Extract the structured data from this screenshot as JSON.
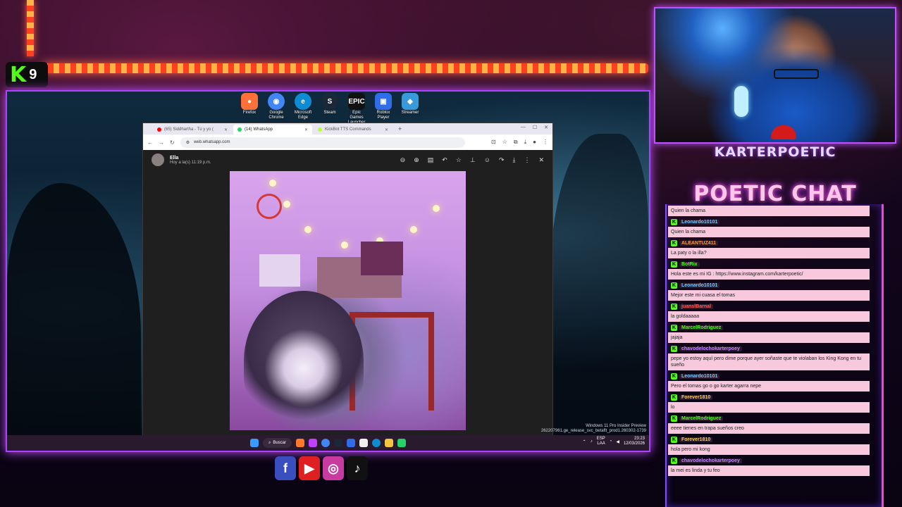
{
  "kick_badge": {
    "logo": "K",
    "count": "9"
  },
  "desktop": {
    "icons": [
      {
        "label": "Firefox",
        "color": "#ff7139"
      },
      {
        "label": "Google Chrome",
        "color": "#4285f4"
      },
      {
        "label": "Microsoft Edge",
        "color": "#0f8bd1"
      },
      {
        "label": "Steam",
        "color": "#1b2838"
      },
      {
        "label": "Epic Games Launcher",
        "color": "#111111"
      },
      {
        "label": "Roblox Player",
        "color": "#2f6ee8"
      },
      {
        "label": "Streamer",
        "color": "#3a9ad9"
      }
    ],
    "watermark_line1": "Windows 11 Pro Insider Preview",
    "watermark_line2": "262207961.ge_release_svc_betaflt_prod1.260302-1739"
  },
  "browser": {
    "tabs": [
      {
        "title": "(65) Siddhartha - Tú y yo (",
        "active": false,
        "dot": "#ff0000"
      },
      {
        "title": "(14) WhatsApp",
        "active": true,
        "dot": "#25d366"
      },
      {
        "title": "KickBot TTS Commands",
        "active": false,
        "dot": "#b8ff3a"
      }
    ],
    "new_tab": "+",
    "url": "web.whatsapp.com"
  },
  "whatsapp": {
    "contact": "Ella",
    "timestamp": "Hoy a la(s) 11:19 p.m."
  },
  "taskbar": {
    "search_label": "Buscar",
    "lang_line1": "ESP",
    "lang_line2": "LAA",
    "time": "23:23",
    "date": "12/03/2026"
  },
  "streamer": {
    "name": "KARTERPOETIC"
  },
  "chat": {
    "title": "POETIC CHAT",
    "first_text": "Quien la chama",
    "messages": [
      {
        "user": "Leonardo10101",
        "color": "#7ec8ff",
        "badge": "K",
        "text": "Quien la chama"
      },
      {
        "user": "ALEANTUZ411",
        "color": "#ff9a3a",
        "badge": "K",
        "text": "La paty o la illa?"
      },
      {
        "user": "BotRix",
        "color": "#53fc18",
        "badge": "K",
        "text": "Hola este es mi IG : https://www.instagram.com/karterpoetic/"
      },
      {
        "user": "Leonardo10101",
        "color": "#7ec8ff",
        "badge": "K",
        "text": "Mejor este mi cuasa el tomas"
      },
      {
        "user": "juanslBarnal",
        "color": "#ff6060",
        "badge": "K",
        "text": "la goldaaaaa"
      },
      {
        "user": "MarcelRodriguez",
        "color": "#53fc18",
        "badge": "K",
        "text": "jajaja"
      },
      {
        "user": "chavodelochokarterpoey",
        "color": "#c08aff",
        "badge": "K",
        "text": "pepe yo estoy aquí pero dime porque ayer soñaste que te violaban los King Kong en tu sueño"
      },
      {
        "user": "Leonardo10101",
        "color": "#7ec8ff",
        "badge": "K",
        "text": "Pero el tomas go o go karter agarra nepe"
      },
      {
        "user": "Forever1810",
        "color": "#ffd040",
        "badge": "K",
        "text": "lo"
      },
      {
        "user": "MarcelRodriguez",
        "color": "#53fc18",
        "badge": "K",
        "text": "eeee tienes en trapa sueños creo"
      },
      {
        "user": "Forever1810",
        "color": "#ffd040",
        "badge": "K",
        "text": "hola pero mi kong"
      },
      {
        "user": "chavodelochokarterpoey",
        "color": "#c08aff",
        "badge": "K",
        "text": "la mei es linda y tu feo"
      }
    ]
  }
}
